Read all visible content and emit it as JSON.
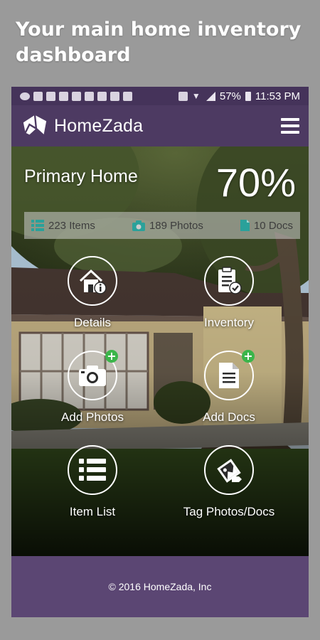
{
  "caption": "Your main home inventory dashboard",
  "status_bar": {
    "battery": "57%",
    "time": "11:53 PM"
  },
  "app_bar": {
    "brand": "HomeZada",
    "logo_icon": "house-logo-icon",
    "menu_icon": "hamburger-menu-icon"
  },
  "dashboard": {
    "home_name": "Primary Home",
    "completion": "70%",
    "stats": [
      {
        "label": "223 Items",
        "icon": "list-icon"
      },
      {
        "label": "189 Photos",
        "icon": "camera-icon"
      },
      {
        "label": "10 Docs",
        "icon": "document-icon"
      }
    ],
    "tiles": [
      {
        "label": "Details",
        "icon": "house-info-icon"
      },
      {
        "label": "Inventory",
        "icon": "clipboard-check-icon"
      },
      {
        "label": "Add Photos",
        "icon": "camera-add-icon",
        "badge": "+"
      },
      {
        "label": "Add Docs",
        "icon": "document-add-icon",
        "badge": "+"
      },
      {
        "label": "Item List",
        "icon": "bullet-list-icon"
      },
      {
        "label": "Tag Photos/Docs",
        "icon": "tag-photos-icon"
      }
    ]
  },
  "footer": {
    "copyright": "© 2016 HomeZada, Inc"
  },
  "colors": {
    "brand_purple": "#4d3a62",
    "status_purple": "#45335a",
    "footer_purple": "#5b4673",
    "badge_green": "#3bb54a",
    "caption_bg": "#9a9a9a"
  }
}
